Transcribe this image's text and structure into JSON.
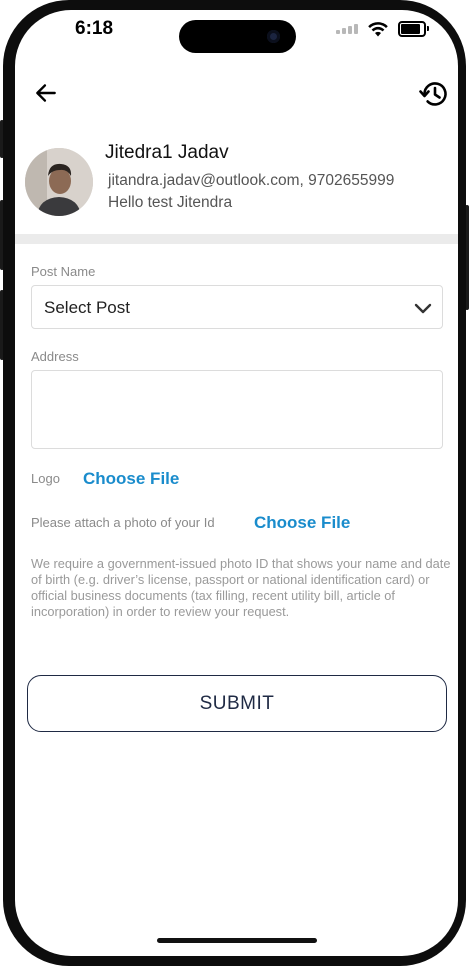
{
  "status_bar": {
    "time": "6:18",
    "icons": [
      "cellular-signal-icon",
      "wifi-icon",
      "battery-icon"
    ]
  },
  "top_bar": {
    "back_icon": "arrow-left-icon",
    "history_icon": "history-icon"
  },
  "profile": {
    "name": "Jitedra1 Jadav",
    "contact": "jitandra.jadav@outlook.com, 9702655999",
    "bio": "Hello test Jitendra"
  },
  "form": {
    "post_label": "Post Name",
    "post_value": "Select Post",
    "address_label": "Address",
    "address_value": "",
    "logo_label": "Logo",
    "logo_choose": "Choose File",
    "id_label": "Please attach a photo of your Id",
    "id_choose": "Choose File",
    "notice": "We require a government-issued photo ID that shows your name and date of birth (e.g. driver’s license, passport or national identification card) or official business documents (tax filling, recent utility bill, article of incorporation) in order to review your request.",
    "submit": "SUBMIT"
  },
  "colors": {
    "accent": "#1a8ccc",
    "submit_border": "#1f2a44",
    "divider": "#ebebeb"
  }
}
